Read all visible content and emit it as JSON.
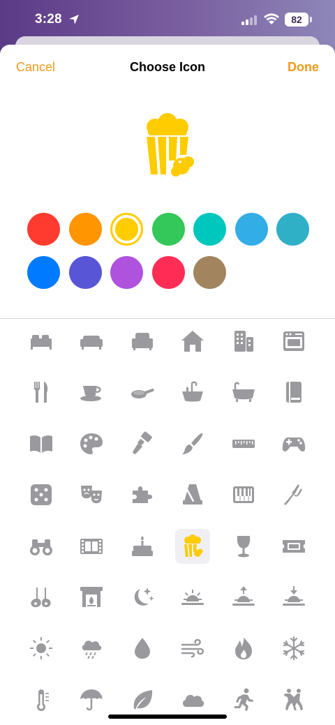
{
  "status_bar": {
    "time": "3:28",
    "battery": "82"
  },
  "nav": {
    "cancel": "Cancel",
    "title": "Choose Icon",
    "done": "Done"
  },
  "preview": {
    "icon": "popcorn-icon",
    "color": "#ffcc00"
  },
  "colors": {
    "selected_index": 2,
    "options": [
      "#ff3b30",
      "#ff9500",
      "#ffcc00",
      "#34c759",
      "#00c7be",
      "#32ade6",
      "#30b0c7",
      "#007aff",
      "#5856d6",
      "#af52de",
      "#ff2d55",
      "#a2845e"
    ]
  },
  "icons": {
    "selected": "popcorn-icon",
    "color": "#9a9a9e",
    "rows": [
      [
        "bed-icon",
        "sofa-icon",
        "armchair-icon",
        "house-icon",
        "building-icon",
        "oven-icon"
      ],
      [
        "fork-knife-icon",
        "cup-saucer-icon",
        "frying-pan-icon",
        "sink-icon",
        "bathtub-icon",
        "book-closed-icon"
      ],
      [
        "book-open-icon",
        "paint-palette-icon",
        "paintbrush-wide-icon",
        "paintbrush-icon",
        "ruler-icon",
        "gamecontroller-icon"
      ],
      [
        "die-icon",
        "theater-masks-icon",
        "puzzle-icon",
        "metronome-icon",
        "piano-keys-icon",
        "tuning-fork-icon"
      ],
      [
        "binoculars-icon",
        "film-icon",
        "birthday-cake-icon",
        "popcorn-icon",
        "wineglass-icon",
        "ticket-icon"
      ],
      [
        "guitars-icon",
        "fireplace-icon",
        "moon-stars-icon",
        "sunrise-icon",
        "sunrise-arrow-icon",
        "sunset-icon"
      ],
      [
        "sun-icon",
        "cloud-rain-icon",
        "drop-icon",
        "wind-icon",
        "flame-icon",
        "snowflake-icon"
      ],
      [
        "thermometer-icon",
        "umbrella-icon",
        "leaf-icon",
        "cloud-icon",
        "figure-run-icon",
        "figure-dance-icon"
      ]
    ]
  }
}
